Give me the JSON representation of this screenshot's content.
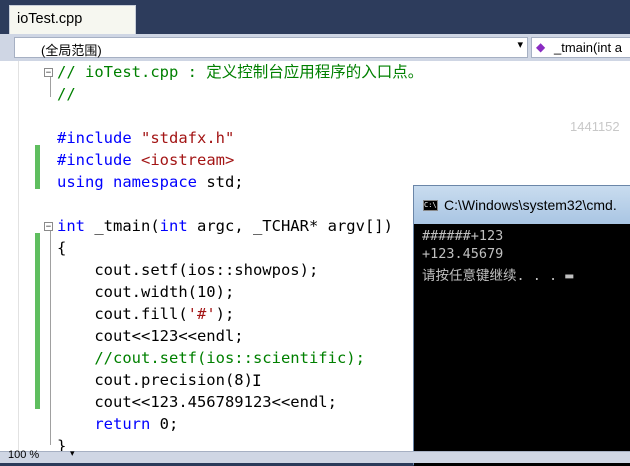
{
  "tab": {
    "title": "ioTest.cpp",
    "close_glyph": "×"
  },
  "navbar": {
    "scope": "(全局范围)",
    "function": "_tmain(int a"
  },
  "editor": {
    "lines": [
      {
        "parts": [
          {
            "t": "// ioTest.cpp : 定义控制台应用程序的入口点。",
            "c": "cm"
          }
        ]
      },
      {
        "parts": [
          {
            "t": "//",
            "c": "cm"
          }
        ]
      },
      {
        "parts": []
      },
      {
        "parts": [
          {
            "t": "#include ",
            "c": "pp"
          },
          {
            "t": "\"stdafx.h\"",
            "c": "str"
          }
        ]
      },
      {
        "parts": [
          {
            "t": "#include ",
            "c": "pp"
          },
          {
            "t": "<iostream>",
            "c": "str"
          }
        ]
      },
      {
        "parts": [
          {
            "t": "using namespace ",
            "c": "kw"
          },
          {
            "t": "std;",
            "c": ""
          }
        ]
      },
      {
        "parts": []
      },
      {
        "parts": [
          {
            "t": "int",
            "c": "kw"
          },
          {
            "t": " _tmain(",
            "c": ""
          },
          {
            "t": "int",
            "c": "kw"
          },
          {
            "t": " argc, _TCHAR* argv[])",
            "c": ""
          }
        ]
      },
      {
        "parts": [
          {
            "t": "{",
            "c": ""
          }
        ]
      },
      {
        "parts": [
          {
            "t": "    cout.setf(ios::showpos);",
            "c": ""
          }
        ]
      },
      {
        "parts": [
          {
            "t": "    cout.width(10);",
            "c": ""
          }
        ]
      },
      {
        "parts": [
          {
            "t": "    cout.fill(",
            "c": ""
          },
          {
            "t": "'#'",
            "c": "str"
          },
          {
            "t": ");",
            "c": ""
          }
        ]
      },
      {
        "parts": [
          {
            "t": "    cout<<123<<endl;",
            "c": ""
          }
        ]
      },
      {
        "parts": [
          {
            "t": "    //cout.setf(ios::scientific);",
            "c": "cm"
          }
        ]
      },
      {
        "parts": [
          {
            "t": "    cout.precision(8)",
            "c": ""
          }
        ]
      },
      {
        "parts": [
          {
            "t": "    cout<<123.456789123<<endl;",
            "c": ""
          }
        ]
      },
      {
        "parts": [
          {
            "t": "    ",
            "c": ""
          },
          {
            "t": "return",
            "c": "kw"
          },
          {
            "t": " 0;",
            "c": ""
          }
        ]
      },
      {
        "parts": [
          {
            "t": "}",
            "c": ""
          }
        ]
      }
    ],
    "watermark": "1441152"
  },
  "console": {
    "title": "C:\\Windows\\system32\\cmd.",
    "icon_label": "C:\\",
    "output": [
      "######+123",
      "+123.45679",
      "请按任意键继续. . . ▬"
    ]
  },
  "statusbar": {
    "zoom": "100 %",
    "zoom_arrow": "▾"
  },
  "colors": {
    "comment": "#008000",
    "keyword": "#0000ff",
    "string": "#a31515",
    "change_bar": "#5fbe5f",
    "console_bg": "#000000"
  }
}
